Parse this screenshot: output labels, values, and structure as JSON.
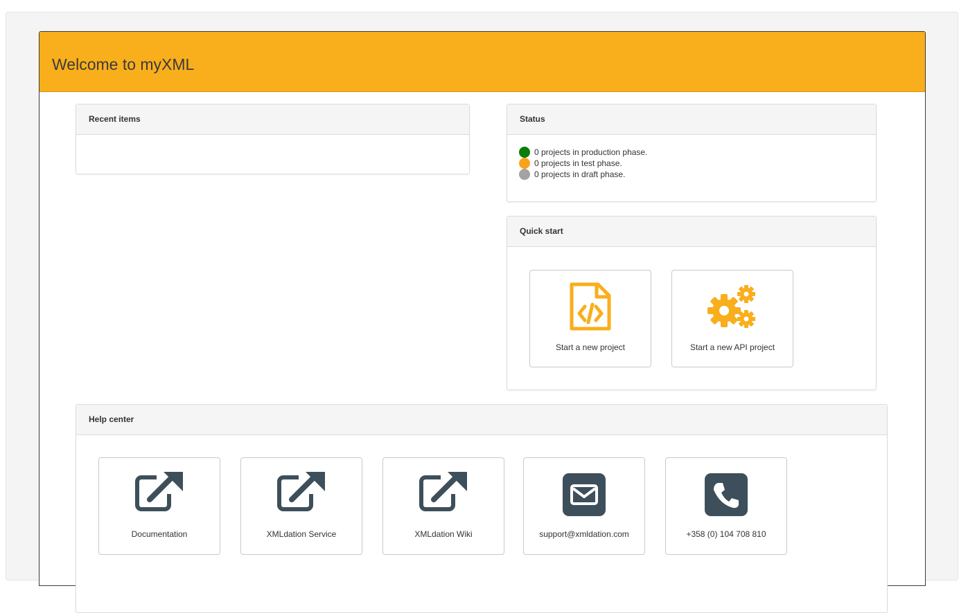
{
  "header": {
    "title": "Welcome to myXML"
  },
  "recent": {
    "title": "Recent items"
  },
  "status": {
    "title": "Status",
    "items": [
      {
        "text": "0 projects in production phase.",
        "color": "#0a7d0a"
      },
      {
        "text": "0 projects in test phase.",
        "color": "#f9a31b"
      },
      {
        "text": "0 projects in draft phase.",
        "color": "#a3a3a3"
      }
    ]
  },
  "quick_start": {
    "title": "Quick start",
    "tiles": [
      {
        "label": "Start a new project",
        "icon": "code-file-icon"
      },
      {
        "label": "Start a new API project",
        "icon": "gears-icon"
      }
    ]
  },
  "help_center": {
    "title": "Help center",
    "tiles": [
      {
        "label": "Documentation",
        "icon": "external-link-icon"
      },
      {
        "label": "XMLdation Service",
        "icon": "external-link-icon"
      },
      {
        "label": "XMLdation Wiki",
        "icon": "external-link-icon"
      },
      {
        "label": "support@xmldation.com",
        "icon": "envelope-icon"
      },
      {
        "label": "+358 (0) 104 708 810",
        "icon": "phone-icon"
      }
    ]
  },
  "colors": {
    "accent": "#f9ae1b",
    "icon_orange": "#f9ae1b",
    "icon_dark": "#3d4f5a"
  }
}
